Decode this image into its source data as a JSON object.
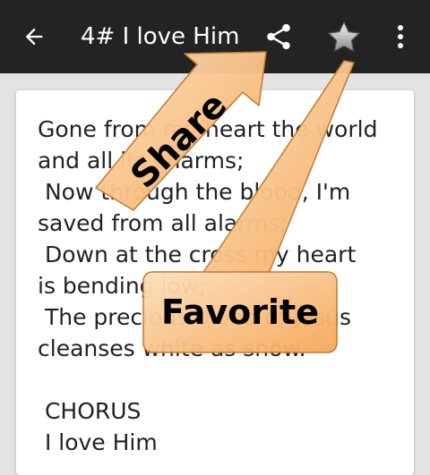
{
  "toolbar": {
    "title": "4# I love Him",
    "back_icon": "arrow-left-icon",
    "share_icon": "share-icon",
    "favorite_icon": "star-icon",
    "overflow_icon": "more-vert-icon",
    "background_color": "#232323"
  },
  "lyrics": {
    "text": "Gone from my heart the world\nand all its charms;\n Now through the blood, I'm\nsaved from all alarms;\n Down at the cross my heart\nis bending low;\n The precious blood of Jesus\ncleanses white as snow.\n\n CHORUS\n I love Him"
  },
  "annotations": {
    "share_label": "Share",
    "favorite_label": "Favorite",
    "callout_color": "#f9b66e"
  }
}
